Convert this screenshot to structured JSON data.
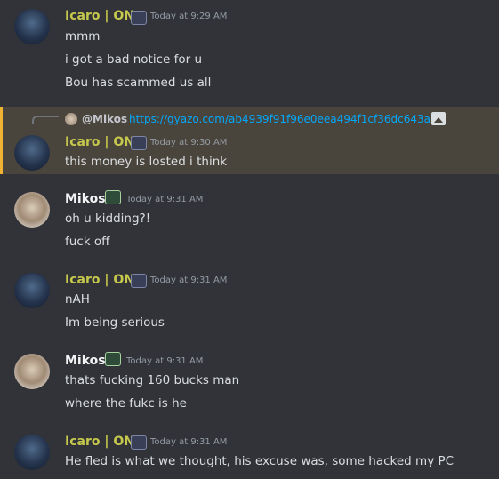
{
  "messages": [
    {
      "author": "Icaro | ON",
      "timestamp": "Today at 9:29 AM",
      "lines": [
        "mmm",
        "i got a bad notice for u",
        "Bou has scammed us all"
      ]
    },
    {
      "reply_to": {
        "author": "@Mikos",
        "content": "https://gyazo.com/ab4939f91f96e0eea494f1cf36dc643a"
      },
      "author": "Icaro | ON",
      "timestamp": "Today at 9:30 AM",
      "lines": [
        "this money is losted i think"
      ]
    },
    {
      "author": "Mikos",
      "timestamp": "Today at 9:31 AM",
      "lines": [
        "oh u kidding?!",
        "fuck off"
      ]
    },
    {
      "author": "Icaro | ON",
      "timestamp": "Today at 9:31 AM",
      "lines": [
        "nAH",
        "Im being serious"
      ]
    },
    {
      "author": "Mikos",
      "timestamp": "Today at 9:31 AM",
      "lines": [
        "thats fucking 160 bucks man",
        "where the fukc is he"
      ]
    },
    {
      "author": "Icaro | ON",
      "timestamp": "Today at 9:31 AM",
      "lines": [
        "He fled is what we thought, his excuse was, some hacked my PC"
      ]
    }
  ],
  "colors": {
    "background": "#313338",
    "icaro_name": "#c5c84c",
    "mikos_name": "#f2f3f5",
    "link": "#00a8fc",
    "highlight": "#4a453c",
    "highlight_bar": "#f0b232"
  },
  "icons": {
    "icaro_badge": "crest-badge-icon",
    "mikos_badge": "welcome-badge-icon",
    "reply": "reply-curve-icon",
    "attachment": "image-icon"
  }
}
